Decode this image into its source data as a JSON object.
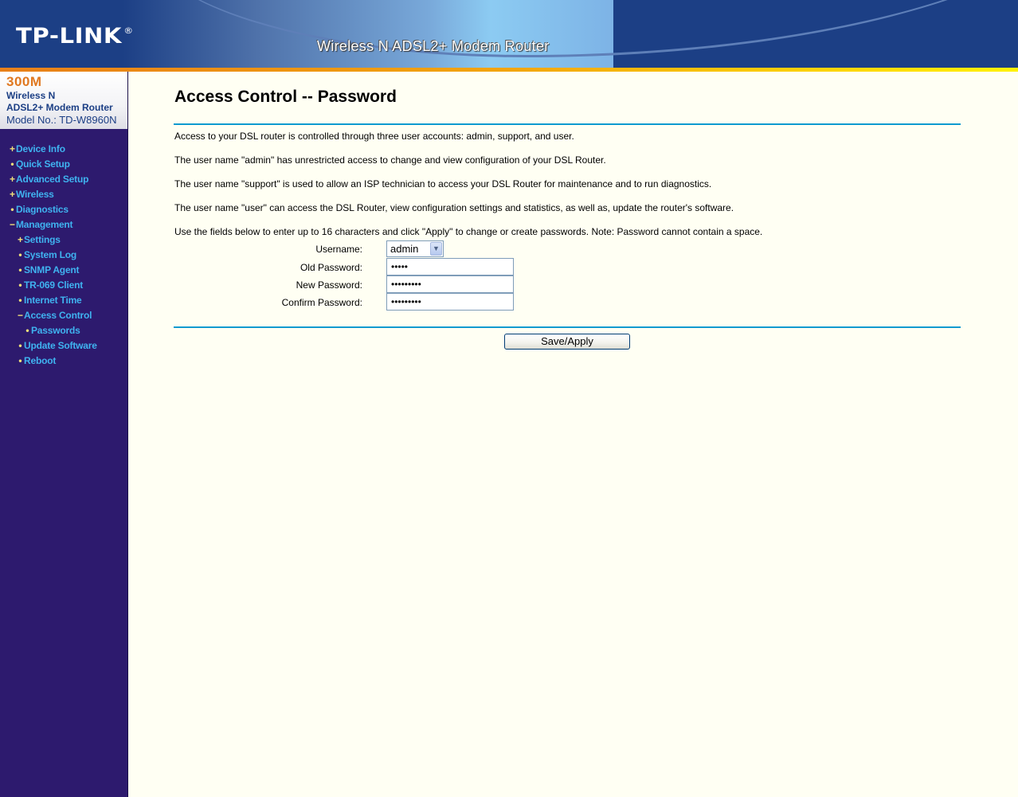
{
  "header": {
    "brand": "TP-LINK",
    "brand_mark": "®",
    "product_title": "Wireless N ADSL2+ Modem Router"
  },
  "sidebar": {
    "model": {
      "speed": "300M",
      "line1": "Wireless N",
      "line2": "ADSL2+ Modem Router",
      "model_no": "Model No.: TD-W8960N"
    },
    "items": [
      {
        "label": "Device Info",
        "bullet": "+",
        "level": 0
      },
      {
        "label": "Quick Setup",
        "bullet": "•",
        "level": 0
      },
      {
        "label": "Advanced Setup",
        "bullet": "+",
        "level": 0
      },
      {
        "label": "Wireless",
        "bullet": "+",
        "level": 0
      },
      {
        "label": "Diagnostics",
        "bullet": "•",
        "level": 0
      },
      {
        "label": "Management",
        "bullet": "−",
        "level": 0
      },
      {
        "label": "Settings",
        "bullet": "+",
        "level": 1
      },
      {
        "label": "System Log",
        "bullet": "•",
        "level": 1
      },
      {
        "label": "SNMP Agent",
        "bullet": "•",
        "level": 1
      },
      {
        "label": "TR-069 Client",
        "bullet": "•",
        "level": 1
      },
      {
        "label": "Internet Time",
        "bullet": "•",
        "level": 1
      },
      {
        "label": "Access Control",
        "bullet": "−",
        "level": 1
      },
      {
        "label": "Passwords",
        "bullet": "•",
        "level": 2
      },
      {
        "label": "Update Software",
        "bullet": "•",
        "level": 1
      },
      {
        "label": "Reboot",
        "bullet": "•",
        "level": 1
      }
    ]
  },
  "main": {
    "title": "Access Control -- Password",
    "paragraphs": [
      "Access to your DSL router is controlled through three user accounts: admin, support, and user.",
      "The user name \"admin\" has unrestricted access to change and view configuration of your DSL Router.",
      "The user name \"support\" is used to allow an ISP technician to access your DSL Router for maintenance and to run diagnostics.",
      "The user name \"user\" can access the DSL Router, view configuration settings and statistics, as well as, update the router's software.",
      "Use the fields below to enter up to 16 characters and click \"Apply\" to change or create passwords. Note: Password cannot contain a space."
    ],
    "form": {
      "username_label": "Username:",
      "username_value": "admin",
      "old_password_label": "Old Password:",
      "old_password_value": "•••••",
      "new_password_label": "New Password:",
      "new_password_value": "•••••••••",
      "confirm_password_label": "Confirm Password:",
      "confirm_password_value": "•••••••••"
    },
    "save_label": "Save/Apply"
  },
  "colors": {
    "header_blue": "#1C3F85",
    "accent_orange": "#E8801A",
    "sidebar_bg": "#2D1A6E",
    "nav_link": "#3FB3F0",
    "rule": "#0E9ACF",
    "page_bg": "#FFFFF3"
  }
}
